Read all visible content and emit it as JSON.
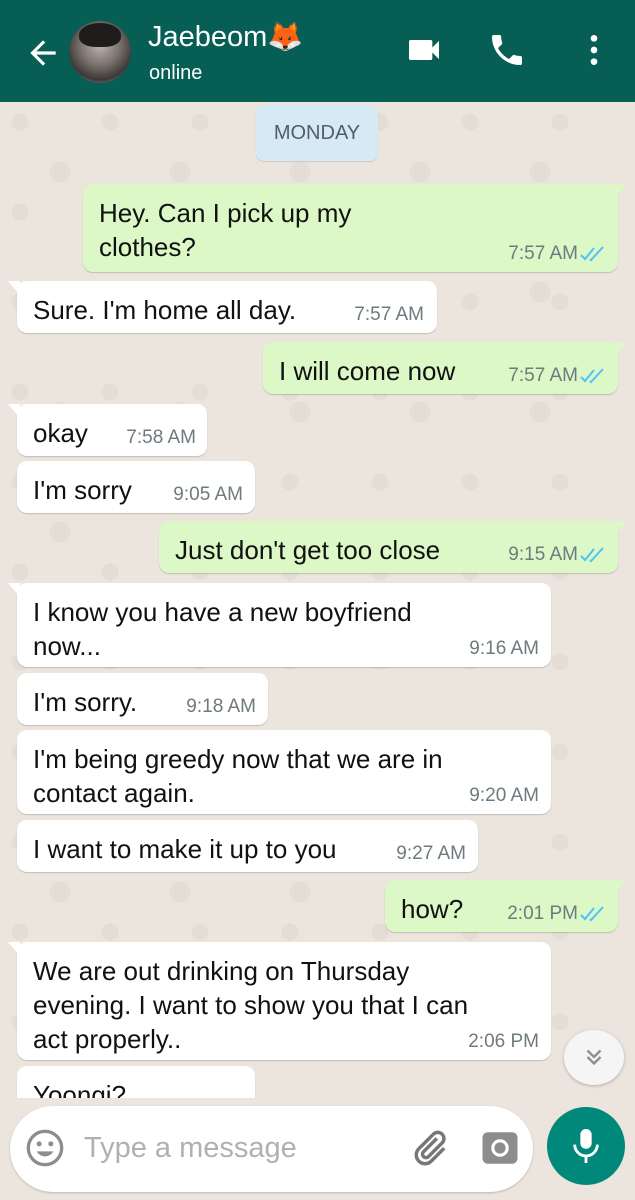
{
  "header": {
    "contact_name": "Jaebeom🦊",
    "status": "online",
    "icons": [
      "back-arrow-icon",
      "video-call-icon",
      "phone-icon",
      "more-vert-icon"
    ],
    "color": "#075e54"
  },
  "day_label": "MONDAY",
  "messages": [
    {
      "direction": "out",
      "text": "Hey. Can I pick up my\nclothes?",
      "time": "7:57 AM",
      "status": "read"
    },
    {
      "direction": "in",
      "text": "Sure. I'm home all day.",
      "time": "7:57 AM"
    },
    {
      "direction": "out",
      "text": "I will come now",
      "time": "7:57 AM",
      "status": "read"
    },
    {
      "direction": "in",
      "text": "okay",
      "time": "7:58 AM"
    },
    {
      "direction": "in",
      "text": "I'm sorry",
      "time": "9:05 AM"
    },
    {
      "direction": "out",
      "text": "Just don't get too close",
      "time": "9:15 AM",
      "status": "read"
    },
    {
      "direction": "in",
      "text": "I know you have a new boyfriend\nnow...",
      "time": "9:16 AM"
    },
    {
      "direction": "in",
      "text": "I'm sorry.",
      "time": "9:18 AM"
    },
    {
      "direction": "in",
      "text": "I'm being greedy now that we are in\ncontact again.",
      "time": "9:20 AM"
    },
    {
      "direction": "in",
      "text": "I want to make it up to you",
      "time": "9:27 AM"
    },
    {
      "direction": "out",
      "text": "how?",
      "time": "2:01 PM",
      "status": "read"
    },
    {
      "direction": "in",
      "text": "We are out drinking on Thursday\nevening. I want to show you that I can\nact properly..",
      "time": "2:06 PM"
    },
    {
      "direction": "in",
      "text": "Yoongi?",
      "time": "",
      "partial": true
    }
  ],
  "composer": {
    "placeholder": "Type a message",
    "icons": [
      "emoji-icon",
      "attach-icon",
      "camera-icon",
      "mic-icon"
    ]
  },
  "colors": {
    "outgoing_bubble": "#dcf8c6",
    "incoming_bubble": "#ffffff",
    "read_ticks": "#4fc3f7",
    "fab": "#00897b"
  }
}
